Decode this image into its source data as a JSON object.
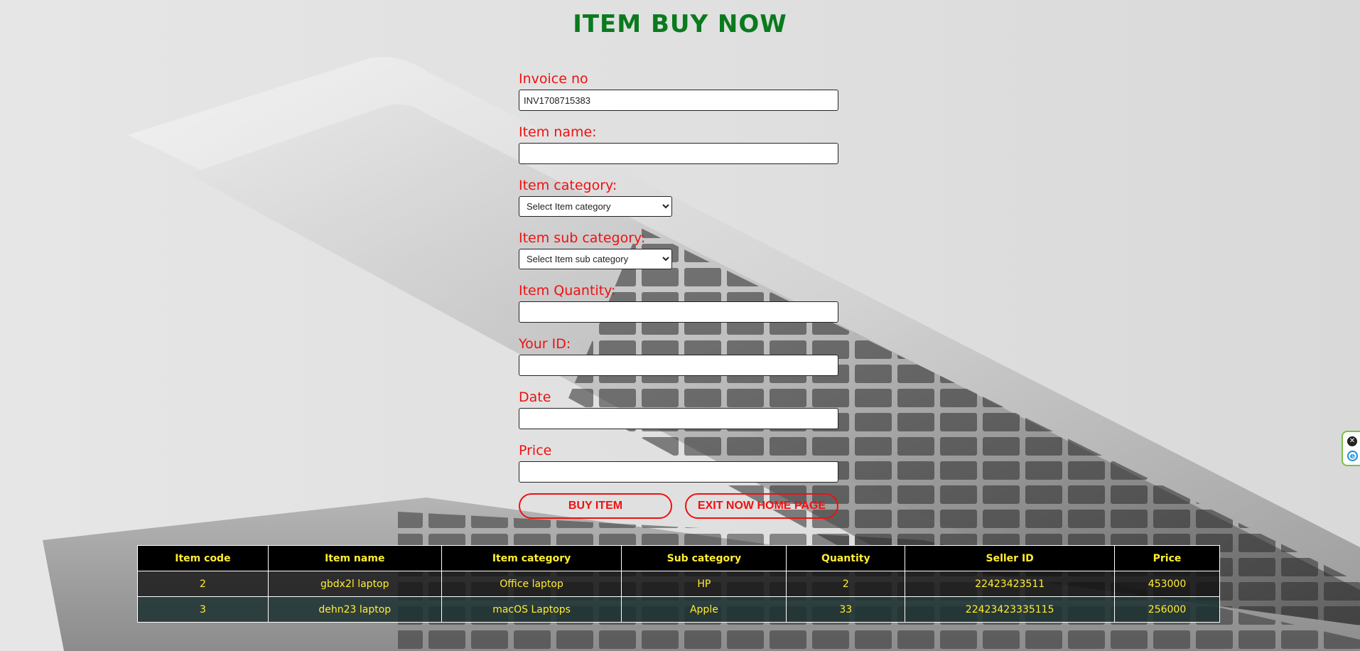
{
  "page": {
    "title": "ITEM BUY NOW"
  },
  "form": {
    "invoice": {
      "label": "Invoice no",
      "value": "INV1708715383"
    },
    "item_name": {
      "label": "Item name:",
      "value": ""
    },
    "category": {
      "label": "Item category:",
      "selected": "Select Item category"
    },
    "sub_category": {
      "label": "Item sub category:",
      "selected": "Select Item sub category"
    },
    "quantity": {
      "label": "Item Quantity:",
      "value": ""
    },
    "your_id": {
      "label": "Your ID:",
      "value": ""
    },
    "date": {
      "label": "Date",
      "value": ""
    },
    "price": {
      "label": "Price",
      "value": ""
    },
    "buy_button": "BUY ITEM",
    "exit_button": "EXIT NOW HOME PAGE"
  },
  "table": {
    "headers": [
      "Item code",
      "Item name",
      "Item category",
      "Sub category",
      "Quantity",
      "Seller ID",
      "Price"
    ],
    "rows": [
      [
        "2",
        "gbdx2l laptop",
        "Office laptop",
        "HP",
        "2",
        "22423423511",
        "453000"
      ],
      [
        "3",
        "dehn23 laptop",
        "macOS Laptops",
        "Apple",
        "33",
        "22423423335115",
        "256000"
      ]
    ]
  },
  "colors": {
    "title": "#0a7a1e",
    "labels": "#ee1111",
    "table_text": "#ffee33",
    "table_header_bg": "#000000"
  },
  "icons": {
    "extension_close": "close-icon",
    "extension_logo": "extension-e-icon"
  }
}
